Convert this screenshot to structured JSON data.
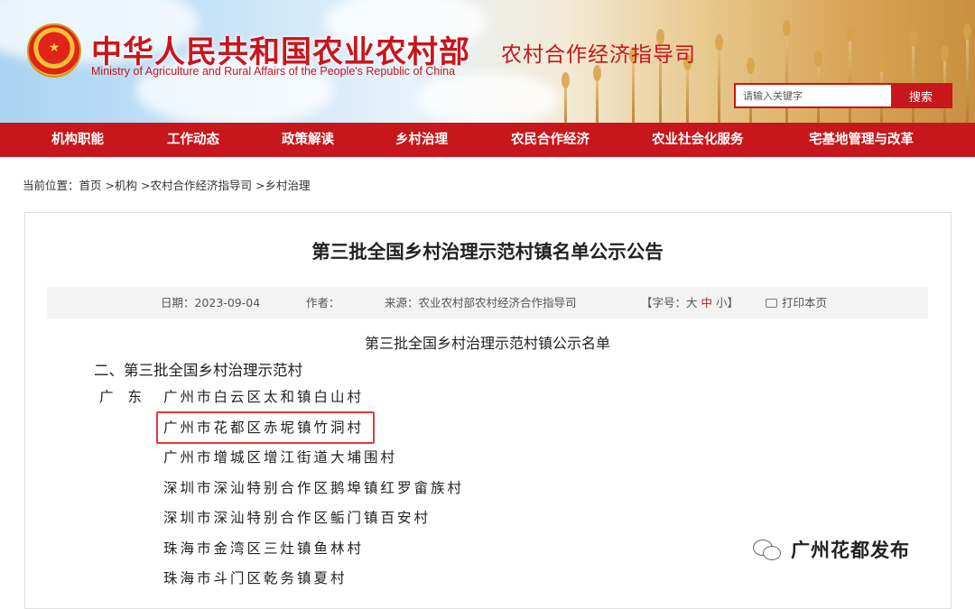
{
  "header": {
    "ministry_cn": "中华人民共和国农业农村部",
    "ministry_en": "Ministry of Agriculture and Rural Affairs of the People's Republic of China",
    "department": "农村合作经济指导司",
    "search_placeholder": "请输入关键字",
    "search_button": "搜索",
    "emblem_icon": "national-emblem"
  },
  "nav": {
    "items": [
      "机构职能",
      "工作动态",
      "政策解读",
      "乡村治理",
      "农民合作经济",
      "农业社会化服务",
      "宅基地管理与改革"
    ]
  },
  "breadcrumb": {
    "label": "当前位置：",
    "items": [
      "首页",
      "机构",
      "农村合作经济指导司",
      "乡村治理"
    ],
    "separator": ">"
  },
  "article": {
    "title": "第三批全国乡村治理示范村镇名单公示公告",
    "meta": {
      "date": "日期：2023-09-04",
      "author": "作者：",
      "source": "来源：农业农村部农村经济合作指导司",
      "font_size_label": "【字号：",
      "font_large": "大",
      "font_medium": "中",
      "font_small": "小】",
      "print": "打印本页"
    },
    "list_heading": "第三批全国乡村治理示范村镇公示名单",
    "section_heading": "二、第三批全国乡村治理示范村",
    "province": "广东",
    "villages": [
      "广州市白云区太和镇白山村",
      "广州市花都区赤坭镇竹洞村",
      "广州市增城区增江街道大埔围村",
      "深圳市深汕特别合作区鹅埠镇红罗畲族村",
      "深圳市深汕特别合作区鲘门镇百安村",
      "珠海市金湾区三灶镇鱼林村",
      "珠海市斗门区乾务镇夏村"
    ],
    "highlighted_index": 1,
    "highlight_color": "#e4393c"
  },
  "watermark": {
    "text": "广州花都发布",
    "icon": "wechat-icon"
  },
  "colors": {
    "brand_red": "#c8161d"
  }
}
